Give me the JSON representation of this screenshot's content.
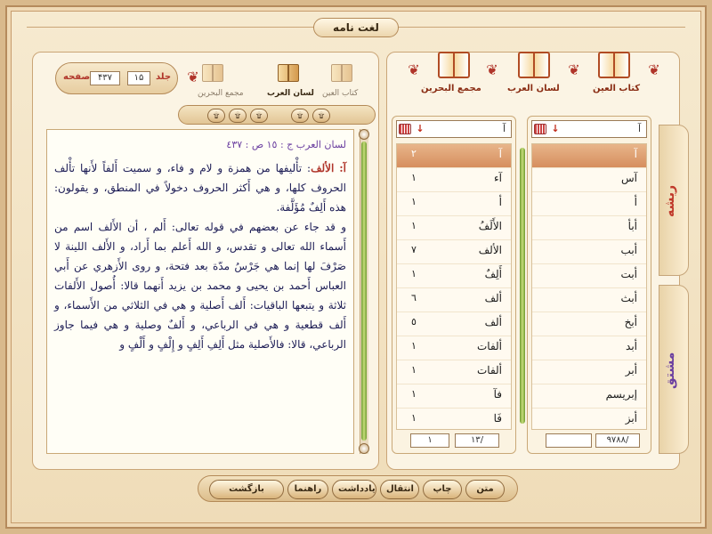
{
  "app": {
    "title": "لغت نامه"
  },
  "left": {
    "volume_label": "جلد",
    "volume_value": "۱۵",
    "page_label": "صفحه",
    "page_value": "۴۳۷",
    "books": [
      {
        "label": "كتاب العين",
        "active": false
      },
      {
        "label": "لسان العرب",
        "active": true
      },
      {
        "label": "مجمع البحرين",
        "active": false
      }
    ],
    "toolbar": [
      "۩",
      "۩",
      "۩",
      "۩",
      "۩"
    ],
    "text": {
      "source": "لسان العرب ج : ١٥ ص : ٤٣٧",
      "head": "آ:",
      "keyword": "الألف",
      "p1": ": تأْليفها من همزة و لام و فاء، و سميت أَلفاً لأَنها تأْلف الحروف كلها، و هي أَكثر الحروف دخولاً في المنطق، و يقولون: هذه أَلِفٌ مُؤَلَّفة.",
      "p2": "و قد جاء عن بعضهم في قوله تعالى: أَلم ، أن الأَلف اسم من أَسماء الله تعالى و تقدس، و الله أَعلم بما أَراد، و الأَلف اللينة لا صَرْفَ لها إنما هي جَرْسُ مدّة بعد فتحة، و روى الأَزهري عن أَبي العباس أَحمد بن يحيى و محمد بن يزيد أَنهما قالا: أُصول الأَلفات ثلاثة و يتبعها الباقيات: أَلف أَصلية و هي في الثلاثي من الأَسماء، و أَلف قطعية و هي في الرباعي، و أَلفٌ وصلية و هي فيما جاوز الرباعي، قالا: فالأَصلية مثل أَلِفِ أَلِفٍ و إِلْفٍ و أَلْفٍ و"
    }
  },
  "right": {
    "books": [
      {
        "label": "كتاب العين"
      },
      {
        "label": "لسان العرب"
      },
      {
        "label": "مجمع البحرين"
      }
    ],
    "root_list": {
      "search": "آ",
      "items": [
        "آ",
        "آس",
        "أ",
        "أبأ",
        "أبب",
        "أبت",
        "أبث",
        "أبخ",
        "أبد",
        "أبر",
        "إبريسم",
        "أبز"
      ],
      "total": "٩٧٨٨/",
      "current": ""
    },
    "word_list": {
      "search": "آ",
      "items": [
        {
          "w": "آ",
          "n": "٢"
        },
        {
          "w": "آء",
          "n": "١"
        },
        {
          "w": "أ",
          "n": "١"
        },
        {
          "w": "الأَلَفُ",
          "n": "١"
        },
        {
          "w": "الألف",
          "n": "٧"
        },
        {
          "w": "أَلِفٌ",
          "n": "١"
        },
        {
          "w": "ألف",
          "n": "٦"
        },
        {
          "w": "ألف",
          "n": "٥"
        },
        {
          "w": "ألفات",
          "n": "١"
        },
        {
          "w": "ألفات",
          "n": "١"
        },
        {
          "w": "فآ",
          "n": "١"
        },
        {
          "w": "فَا",
          "n": "١"
        }
      ],
      "total": "١٣/",
      "current": "١"
    },
    "tabs": [
      {
        "label": "ريشه",
        "color": "#c0392b"
      },
      {
        "label": "مشتق",
        "color": "#6b3fa0"
      }
    ]
  },
  "bottom": [
    "متن",
    "چاپ",
    "انتقال",
    "يادداشت",
    "راهنما",
    "بازگشت"
  ],
  "colors": {
    "accent": "#b0352a",
    "highlight": "#d68e5e",
    "text": "#1c1c55"
  }
}
